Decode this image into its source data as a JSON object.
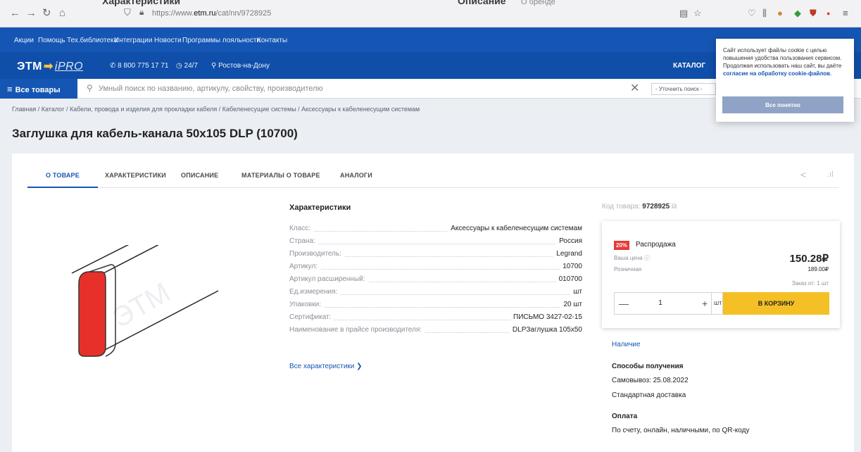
{
  "browser": {
    "ghost_tab_1": "Характеристики",
    "ghost_tab_2": "Описание",
    "ghost_tab_3": "О бренде",
    "url_prefix": "https://www.",
    "url_domain": "etm.ru",
    "url_path": "/cat/nn/9728925"
  },
  "topnav": {
    "links": [
      "Акции",
      "Помощь",
      "Тех.библиотека",
      "Интеграции",
      "Новости",
      "Программы лояльности",
      "Контакты"
    ]
  },
  "brand": {
    "logo_text": "ЭТМ",
    "logo_sub": "iPRO",
    "phone": "8 800 775 17 71",
    "hours": "24/7",
    "city": "Ростов-на-Дону",
    "catalog": "КАТАЛОГ"
  },
  "search": {
    "all_goods_label": "Все товары",
    "placeholder": "Умный поиск по названию, артикулу, свойству, производителю",
    "refine_label": "- Уточнить поиск -"
  },
  "breadcrumb": {
    "text": "Главная / Каталог / Кабели, провода и изделия для прокладки кабеля / Кабеленесущие системы / Аксессуары к кабеленесущим системам"
  },
  "product": {
    "title": "Заглушка для кабель-канала 50х105 DLP (10700)",
    "tabs": [
      "О ТОВАРЕ",
      "ХАРАКТЕРИСТИКИ",
      "ОПИСАНИЕ",
      "МАТЕРИАЛЫ О ТОВАРЕ",
      "АНАЛОГИ"
    ],
    "specs_title": "Характеристики",
    "specs": [
      {
        "label": "Класс:",
        "value": "Аксессуары к кабеленесущим системам"
      },
      {
        "label": "Страна:",
        "value": "Россия"
      },
      {
        "label": "Производитель:",
        "value": "Legrand"
      },
      {
        "label": "Артикул:",
        "value": "10700"
      },
      {
        "label": "Артикул расширенный:",
        "value": "010700"
      },
      {
        "label": "Ед.измерения:",
        "value": "шт"
      },
      {
        "label": "Упаковки:",
        "value": "20 шт"
      },
      {
        "label": "Сертификат:",
        "value": "ПИСЬМО 3427-02-15"
      },
      {
        "label": "Наименование в прайсе производителя:",
        "value": "DLPЗаглушка 105x50"
      }
    ],
    "all_specs_link": "Все характеристики",
    "code_label": "Код товара:",
    "code_value": "9728925"
  },
  "buy": {
    "badge": "20%",
    "sale_label": "Распродажа",
    "your_price_label": "Ваша цена",
    "price": "150.28₽",
    "retail_label": "Розничная",
    "retail_price": "189.00₽",
    "min_order": "Заказ от: 1 шт",
    "quantity": "1",
    "unit": "шт",
    "cart_button": "В КОРЗИНУ"
  },
  "delivery": {
    "availability": "Наличие",
    "methods_title": "Способы получения",
    "pickup": "Самовывоз: 25.08.2022",
    "standard": "Стандартная доставка",
    "payment_title": "Оплата",
    "payment_methods": "По счету, онлайн, наличными, по QR-коду"
  },
  "cookie": {
    "text": "Сайт использует файлы cookie с целью повышения удобства пользования сервисом. Продолжая использовать наш сайт, вы даёте",
    "link": "согласие на обработку cookie-файлов",
    "button": "Все понятно"
  },
  "colors": {
    "brand_blue": "#1556b4",
    "cart_yellow": "#f4c025",
    "badge_red": "#e53935"
  }
}
